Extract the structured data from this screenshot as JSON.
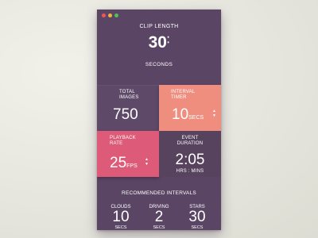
{
  "window": {
    "controls": [
      "close",
      "minimize",
      "zoom"
    ]
  },
  "clip_length": {
    "label": "CLIP LENGTH",
    "value": "30",
    "unit": "SECONDS"
  },
  "total_images": {
    "label_line1": "TOTAL",
    "label_line2": "IMAGES",
    "value": "750"
  },
  "interval_timer": {
    "label_line1": "INTERVAL",
    "label_line2": "TIMER",
    "value": "10",
    "unit": "SECS"
  },
  "playback_rate": {
    "label_line1": "PLAYBACK",
    "label_line2": "RATE",
    "value": "25",
    "unit": "FPS"
  },
  "event_duration": {
    "label_line1": "EVENT",
    "label_line2": "DURATION",
    "value": "2:05",
    "unit": "HRS : MINS"
  },
  "recommended": {
    "title": "RECOMMENDED INTERVALS",
    "items": [
      {
        "name": "CLOUDS",
        "value": "10",
        "unit": "SECS"
      },
      {
        "name": "DRIVING",
        "value": "2",
        "unit": "SECS"
      },
      {
        "name": "STARS",
        "value": "30",
        "unit": "SECS"
      }
    ]
  },
  "colors": {
    "panel": "#5b4565",
    "interval_tile": "#ef8e7f",
    "playback_tile": "#dd5b78",
    "background": "#e9e9e2"
  },
  "icons": {
    "stepper_up": "triangle-up",
    "stepper_down": "triangle-down"
  }
}
